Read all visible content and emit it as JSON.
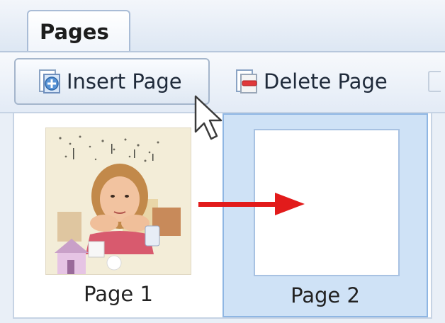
{
  "tabs": {
    "active_label": "Pages"
  },
  "toolbar": {
    "insert_label": "Insert Page",
    "delete_label": "Delete Page"
  },
  "pages": [
    {
      "label": "Page 1",
      "thumbnail": "photo-girl"
    },
    {
      "label": "Page 2",
      "thumbnail": "blank",
      "selected": true
    }
  ],
  "colors": {
    "selection_fill": "#cfe2f6",
    "selection_border": "#8fb6e3",
    "arrow_red": "#e21b1b"
  }
}
